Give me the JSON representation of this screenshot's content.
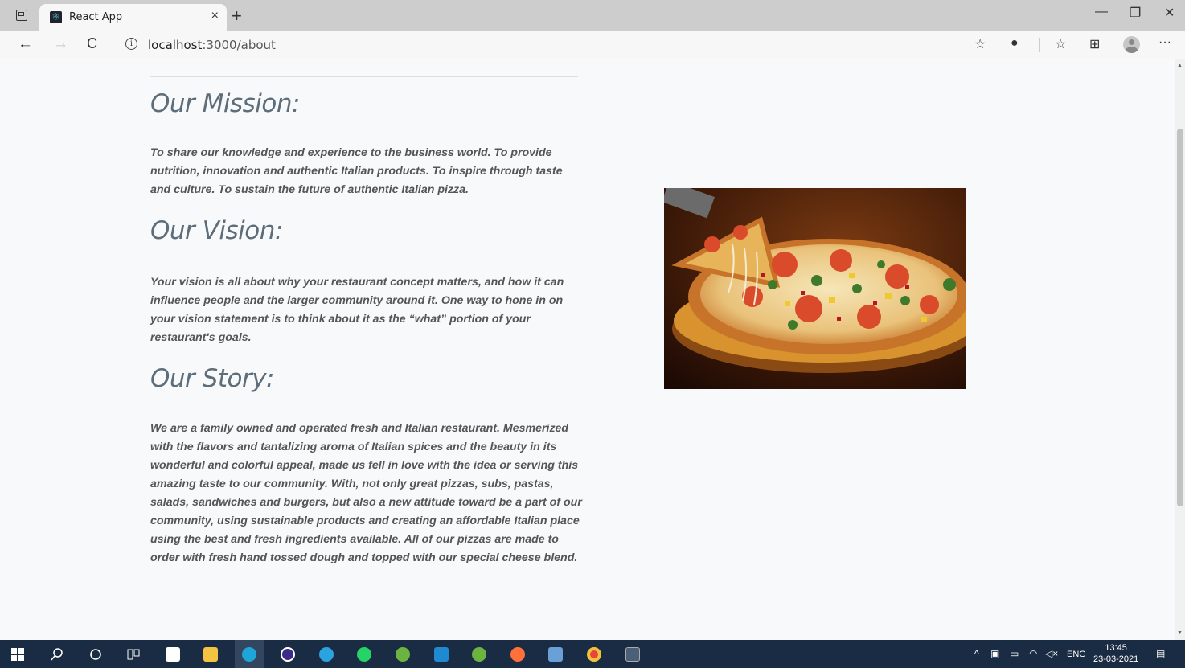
{
  "browser": {
    "tab_title": "React App",
    "tab_close": "×",
    "new_tab": "+",
    "url_host": "localhost",
    "url_rest": ":3000/about",
    "win_min": "—",
    "win_restore": "❐",
    "win_close": "✕",
    "back": "←",
    "forward": "→",
    "reload": "C",
    "more": "···"
  },
  "about": {
    "mission_title": "Our Mission:",
    "mission_text": "To share our knowledge and experience to the business world. To provide nutrition, innovation and authentic Italian products. To inspire through taste and culture. To sustain the future of authentic Italian pizza.",
    "vision_title": "Our Vision:",
    "vision_text": "Your vision is all about why your restaurant concept matters, and how it can influence people and the larger community around it. One way to hone in on your vision statement is to think about it as the “what” portion of your restaurant's goals.",
    "story_title": "Our Story:",
    "story_text": "We are a family owned and operated fresh and Italian restaurant. Mesmerized with the flavors and tantalizing aroma of Italian spices and the beauty in its wonderful and colorful appeal, made us fell in love with the idea or serving this amazing taste to our community. With, not only great pizzas, subs, pastas, salads, sandwiches and burgers, but also a new attitude toward be a part of our community, using sustainable products and creating an affordable Italian place using the best and fresh ingredients available. All of our pizzas are made to order with fresh hand tossed dough and topped with our special cheese blend."
  },
  "taskbar": {
    "language": "ENG",
    "time": "13:45",
    "date": "23-03-2021",
    "apps": [
      {
        "name": "windows-start",
        "color": "#ffffff"
      },
      {
        "name": "search",
        "color": "#ffffff"
      },
      {
        "name": "cortana",
        "color": "#ffffff"
      },
      {
        "name": "task-view",
        "color": "#ffffff"
      },
      {
        "name": "store",
        "color": "#ffffff"
      },
      {
        "name": "file-explorer",
        "color": "#f5c342"
      },
      {
        "name": "edge",
        "color": "#1ea6d8"
      },
      {
        "name": "eclipse",
        "color": "#3b2b8a"
      },
      {
        "name": "telegram",
        "color": "#2aa3df"
      },
      {
        "name": "whatsapp",
        "color": "#25d366"
      },
      {
        "name": "spring-tool",
        "color": "#6db33f"
      },
      {
        "name": "vscode",
        "color": "#1f8ad2"
      },
      {
        "name": "spring-tool-2",
        "color": "#6db33f"
      },
      {
        "name": "firefox",
        "color": "#ff7139"
      },
      {
        "name": "notepad-app",
        "color": "#6aa0d8"
      },
      {
        "name": "chrome",
        "color": "#e8453c"
      },
      {
        "name": "mysql-shell",
        "color": "#4a5f78"
      }
    ]
  }
}
